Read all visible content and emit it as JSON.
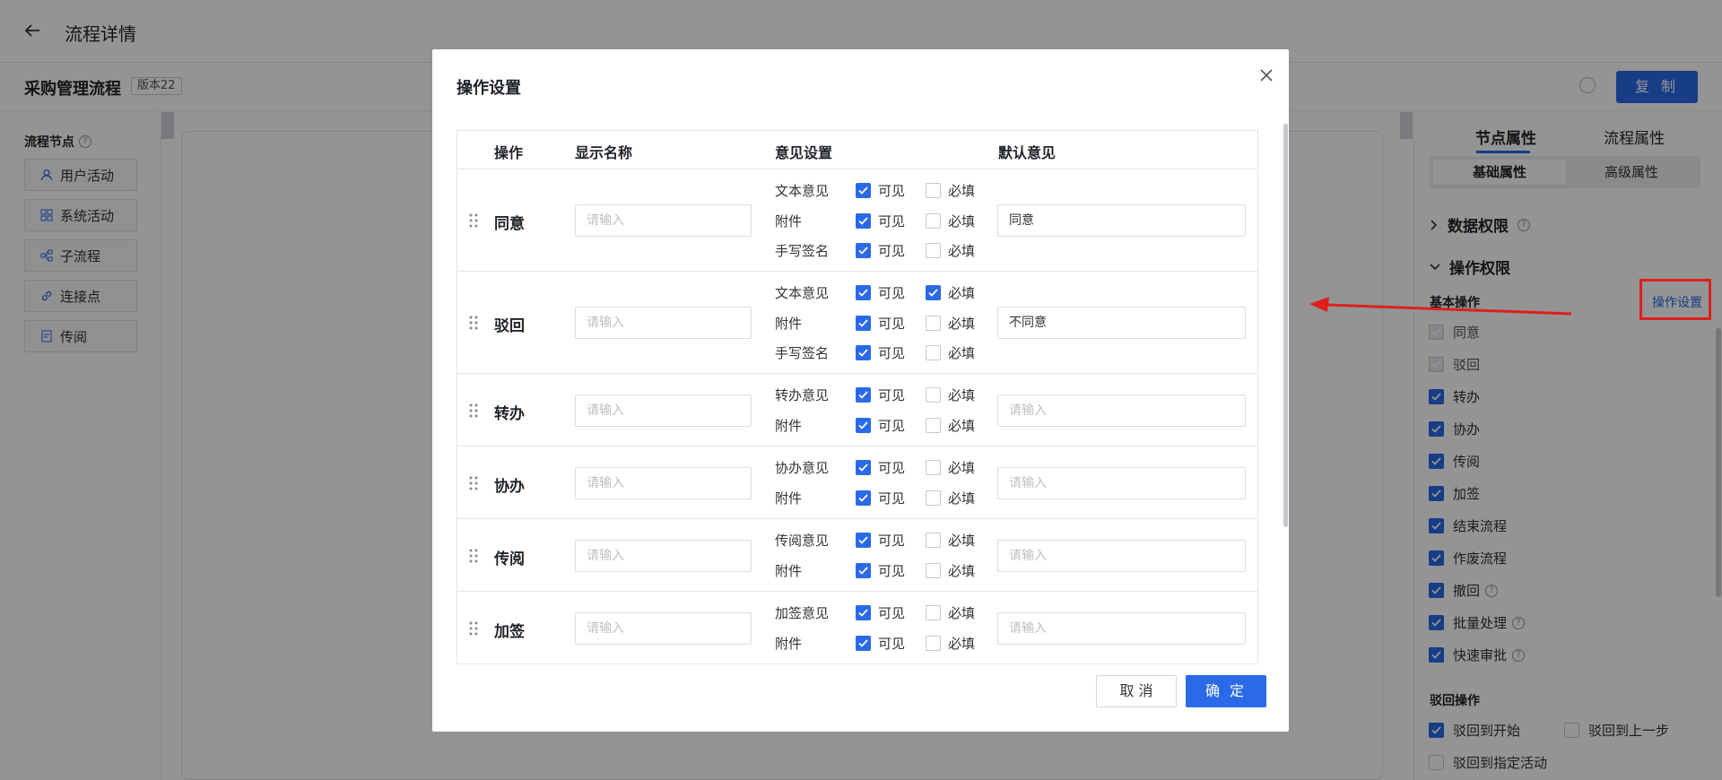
{
  "header": {
    "title": "流程详情",
    "flow_name": "采购管理流程",
    "version": "版本22",
    "copy_label": "复 制"
  },
  "left_panel": {
    "title": "流程节点",
    "nodes": [
      {
        "label": "用户活动",
        "icon": "user-icon"
      },
      {
        "label": "系统活动",
        "icon": "grid-icon"
      },
      {
        "label": "子流程",
        "icon": "subflow-icon"
      },
      {
        "label": "连接点",
        "icon": "link-icon"
      },
      {
        "label": "传阅",
        "icon": "circulate-icon"
      }
    ]
  },
  "right_panel": {
    "tabs": [
      "节点属性",
      "流程属性"
    ],
    "subtabs": [
      "基础属性",
      "高级属性"
    ],
    "section_data": "数据权限",
    "section_ops": "操作权限",
    "basic_ops_label": "基本操作",
    "op_settings_link": "操作设置",
    "basic_ops": [
      {
        "label": "同意",
        "state": "disabled"
      },
      {
        "label": "驳回",
        "state": "disabled"
      },
      {
        "label": "转办",
        "state": "on"
      },
      {
        "label": "协办",
        "state": "on"
      },
      {
        "label": "传阅",
        "state": "on"
      },
      {
        "label": "加签",
        "state": "on"
      },
      {
        "label": "结束流程",
        "state": "on"
      },
      {
        "label": "作废流程",
        "state": "on"
      },
      {
        "label": "撤回",
        "state": "on",
        "help": true
      },
      {
        "label": "批量处理",
        "state": "on",
        "help": true
      },
      {
        "label": "快速审批",
        "state": "on",
        "help": true
      }
    ],
    "reject_label": "驳回操作",
    "reject_ops": [
      {
        "label": "驳回到开始",
        "state": "on"
      },
      {
        "label": "驳回到上一步",
        "state": "off"
      },
      {
        "label": "驳回到指定活动",
        "state": "off"
      }
    ]
  },
  "modal": {
    "title": "操作设置",
    "columns": [
      "操作",
      "显示名称",
      "意见设置",
      "默认意见"
    ],
    "visible_label": "可见",
    "required_label": "必填",
    "name_placeholder": "请输入",
    "rows": [
      {
        "op": "同意",
        "default": "同意",
        "opinions": [
          {
            "label": "文本意见",
            "visible": true,
            "required": false
          },
          {
            "label": "附件",
            "visible": true,
            "required": false
          },
          {
            "label": "手写签名",
            "visible": true,
            "required": false
          }
        ]
      },
      {
        "op": "驳回",
        "default": "不同意",
        "opinions": [
          {
            "label": "文本意见",
            "visible": true,
            "required": true
          },
          {
            "label": "附件",
            "visible": true,
            "required": false
          },
          {
            "label": "手写签名",
            "visible": true,
            "required": false
          }
        ]
      },
      {
        "op": "转办",
        "default": "",
        "opinions": [
          {
            "label": "转办意见",
            "visible": true,
            "required": false
          },
          {
            "label": "附件",
            "visible": true,
            "required": false
          }
        ]
      },
      {
        "op": "协办",
        "default": "",
        "opinions": [
          {
            "label": "协办意见",
            "visible": true,
            "required": false
          },
          {
            "label": "附件",
            "visible": true,
            "required": false
          }
        ]
      },
      {
        "op": "传阅",
        "default": "",
        "opinions": [
          {
            "label": "传阅意见",
            "visible": true,
            "required": false
          },
          {
            "label": "附件",
            "visible": true,
            "required": false
          }
        ]
      },
      {
        "op": "加签",
        "default": "",
        "opinions": [
          {
            "label": "加签意见",
            "visible": true,
            "required": false
          },
          {
            "label": "附件",
            "visible": true,
            "required": false
          }
        ]
      }
    ],
    "cancel_label": "取 消",
    "ok_label": "确 定"
  },
  "colors": {
    "primary": "#2a6ae8",
    "annotation": "#e01e1e"
  }
}
